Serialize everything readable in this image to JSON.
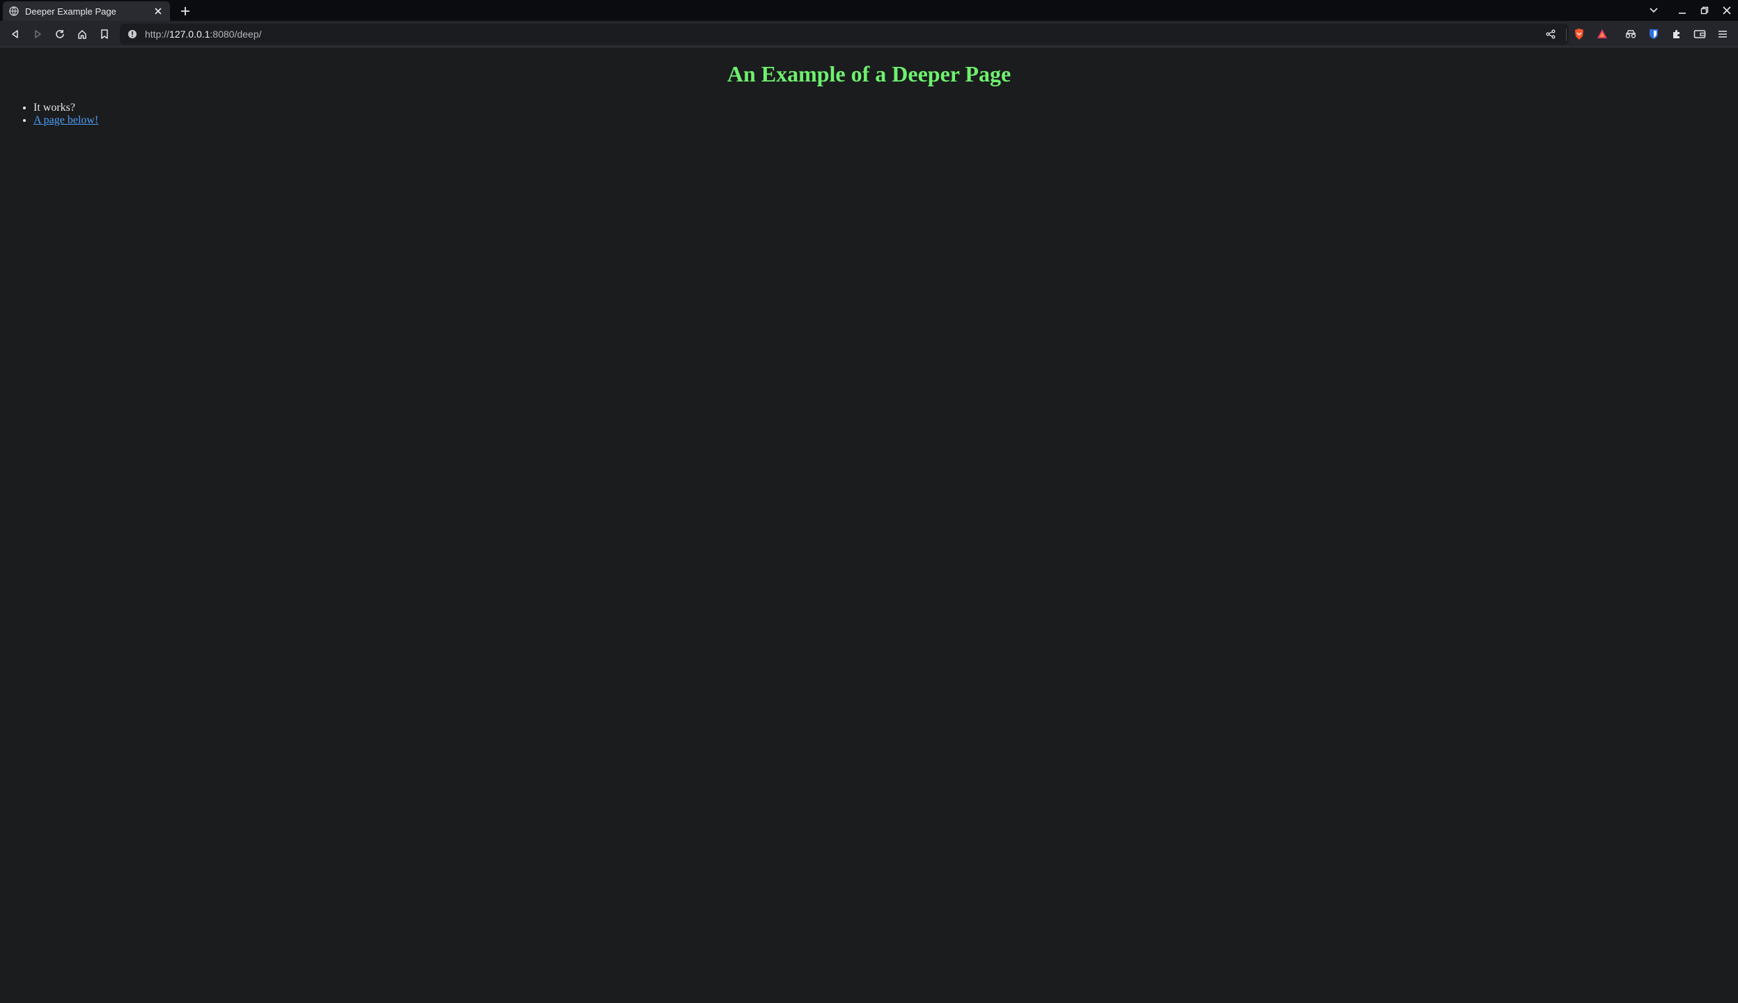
{
  "browser": {
    "tab": {
      "title": "Deeper Example Page"
    },
    "address_bar": {
      "scheme": "http://",
      "host": "127.0.0.1",
      "rest": ":8080/deep/"
    }
  },
  "page": {
    "heading": "An Example of a Deeper Page",
    "items": [
      {
        "text": "It works?",
        "is_link": false
      },
      {
        "text": "A page below!",
        "is_link": true
      }
    ]
  },
  "colors": {
    "heading": "#6ef06e",
    "link": "#4d9ef7",
    "background": "#1b1c1e"
  }
}
